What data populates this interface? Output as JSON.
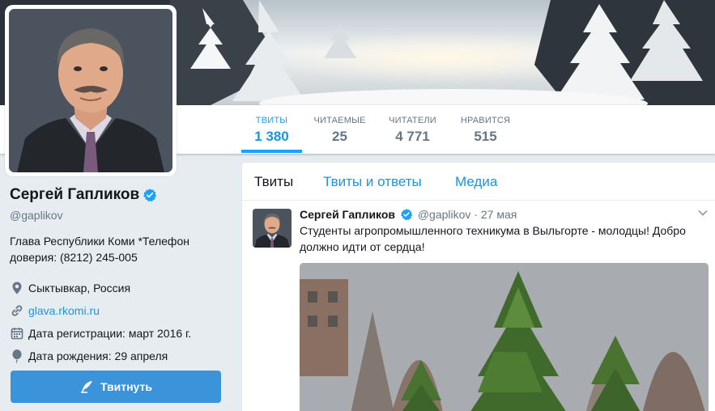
{
  "profile": {
    "name": "Сергей Гапликов",
    "handle": "@gaplikov",
    "bio": "Глава Республики Коми *Телефон доверия: (8212) 245-005",
    "location": "Сыктывкар, Россия",
    "website": "glava.rkomi.ru",
    "joined": "Дата регистрации: март 2016 г.",
    "birthday": "Дата рождения: 29 апреля",
    "tweet_button": "Твитнуть"
  },
  "stats": [
    {
      "label": "ТВИТЫ",
      "value": "1 380"
    },
    {
      "label": "ЧИТАЕМЫЕ",
      "value": "25"
    },
    {
      "label": "ЧИТАТЕЛИ",
      "value": "4 771"
    },
    {
      "label": "НРАВИТСЯ",
      "value": "515"
    }
  ],
  "timeline": {
    "tabs": [
      "Твиты",
      "Твиты и ответы",
      "Медиа"
    ],
    "tweet": {
      "name": "Сергей Гапликов",
      "handle": "@gaplikov",
      "separator": "·",
      "date": "27 мая",
      "text": "Студенты агропромышленного техникума в Выльгорте - молодцы! Добро должно идти от сердца!"
    }
  },
  "colors": {
    "accent": "#1da1f2",
    "link": "#1b95e0",
    "button": "#3b94d9",
    "background": "#e6ecf0"
  },
  "icons": [
    "verified-badge-icon",
    "location-pin-icon",
    "link-icon",
    "calendar-icon",
    "balloon-icon",
    "quill-icon",
    "chevron-down-icon"
  ]
}
